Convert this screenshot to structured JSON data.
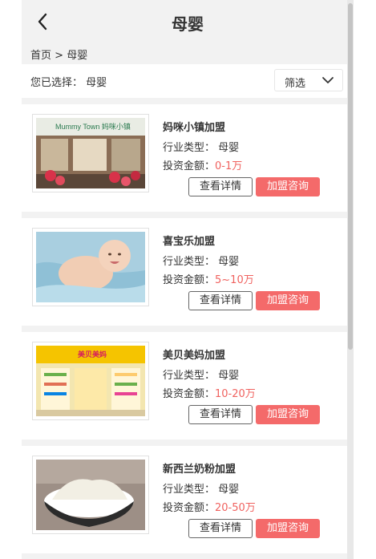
{
  "header": {
    "title": "母婴",
    "back_icon": "chevron-left-icon"
  },
  "breadcrumb": {
    "home": "首页",
    "separator": ">",
    "current": "母婴"
  },
  "filter": {
    "selected_label": "您已选择：",
    "selected_value": "母婴",
    "filter_button": "筛选",
    "filter_icon": "chevron-down-icon"
  },
  "list_labels": {
    "industry_label": "行业类型：",
    "investment_label": "投资金额：",
    "detail_button": "查看详情",
    "consult_button": "加盟咨询"
  },
  "colors": {
    "accent": "#f46a6a",
    "amount": "#f0625f",
    "background": "#f2f2f2"
  },
  "items": [
    {
      "name": "妈咪小镇加盟",
      "industry": "母婴",
      "investment": "0-1万",
      "image": "store-front",
      "sign_text": "Mummy Town 妈咪小镇"
    },
    {
      "name": "喜宝乐加盟",
      "industry": "母婴",
      "investment": "5~10万",
      "image": "baby-photo"
    },
    {
      "name": "美贝美妈加盟",
      "industry": "母婴",
      "investment": "10-20万",
      "image": "shop-interior",
      "sign_text": "美贝美妈"
    },
    {
      "name": "新西兰奶粉加盟",
      "industry": "母婴",
      "investment": "20-50万",
      "image": "milk-powder-bowl"
    }
  ]
}
